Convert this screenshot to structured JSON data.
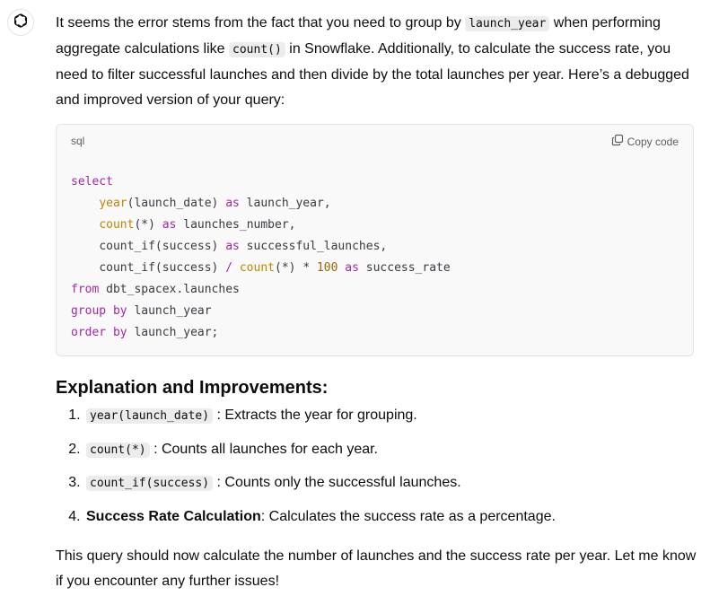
{
  "assistant": {
    "avatar_icon": "openai-logo-icon"
  },
  "intro": {
    "p1": "It seems the error stems from the fact that you need to group by ",
    "code1": "launch_year",
    "p2": " when performing aggregate calculations like ",
    "code2": "count()",
    "p3": " in Snowflake. Additionally, to calculate the success rate, you need to filter successful launches and then divide by the total launches per year. Here’s a debugged and improved version of your query:"
  },
  "code_block": {
    "language": "sql",
    "copy_label": "Copy code",
    "t_select": "select",
    "t_year": "year",
    "t_l1": "(launch_date) ",
    "t_as": "as",
    "t_l1b": " launch_year,",
    "t_count": "count",
    "t_star": "(*) ",
    "t_l2b": " launches_number,",
    "t_l3a": "count_if(success) ",
    "t_l3b": " successful_launches,",
    "t_l4a": "count_if(success) ",
    "t_slash": "/",
    "t_mul": "*",
    "t_100": "100",
    "t_l4b": " success_rate",
    "t_from": "from",
    "t_from_rest": " dbt_spacex.launches",
    "t_group": "group",
    "t_by": "by",
    "t_group_rest": " launch_year",
    "t_order": "order",
    "t_order_rest": " launch_year;"
  },
  "explanation": {
    "heading": "Explanation and Improvements:",
    "items": [
      {
        "code": "year(launch_date)",
        "text": ": Extracts the year for grouping."
      },
      {
        "code": "count(*)",
        "text": ": Counts all launches for each year."
      },
      {
        "code": "count_if(success)",
        "text": ": Counts only the successful launches."
      },
      {
        "bold": "Success Rate Calculation",
        "text": ": Calculates the success rate as a percentage."
      }
    ]
  },
  "closing": "This query should now calculate the number of launches and the success rate per year. Let me know if you encounter any further issues!"
}
